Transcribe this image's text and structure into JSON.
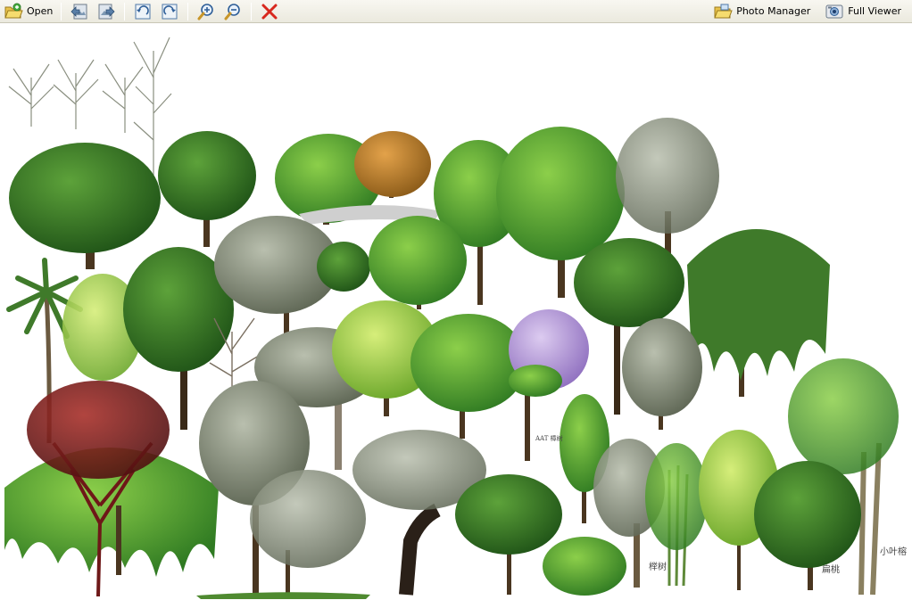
{
  "toolbar": {
    "open_label": "Open",
    "photo_manager_label": "Photo Manager",
    "full_viewer_label": "Full Viewer",
    "icons": {
      "open": "folder-open-icon",
      "previous": "previous-image-icon",
      "next": "next-image-icon",
      "rotate_left": "rotate-left-icon",
      "rotate_right": "rotate-right-icon",
      "zoom_in": "zoom-in-icon",
      "zoom_out": "zoom-out-icon",
      "delete": "delete-icon",
      "photo_manager": "photo-manager-icon",
      "full_viewer": "full-viewer-icon"
    }
  },
  "image": {
    "labels": {
      "label_1": "AAT 樟树",
      "label_2": "榉树",
      "label_3": "扁桃",
      "label_4": "小叶榕"
    }
  },
  "colors": {
    "toolbar_bg": "#ece9d8",
    "delete_red": "#d8281e",
    "tree_dark_green": "#2f6b22",
    "tree_light_green": "#6fbf3a",
    "tree_red": "#7a1a1a",
    "tree_orange": "#c07a2a",
    "tree_purple_flowers": "#b69bd8"
  }
}
